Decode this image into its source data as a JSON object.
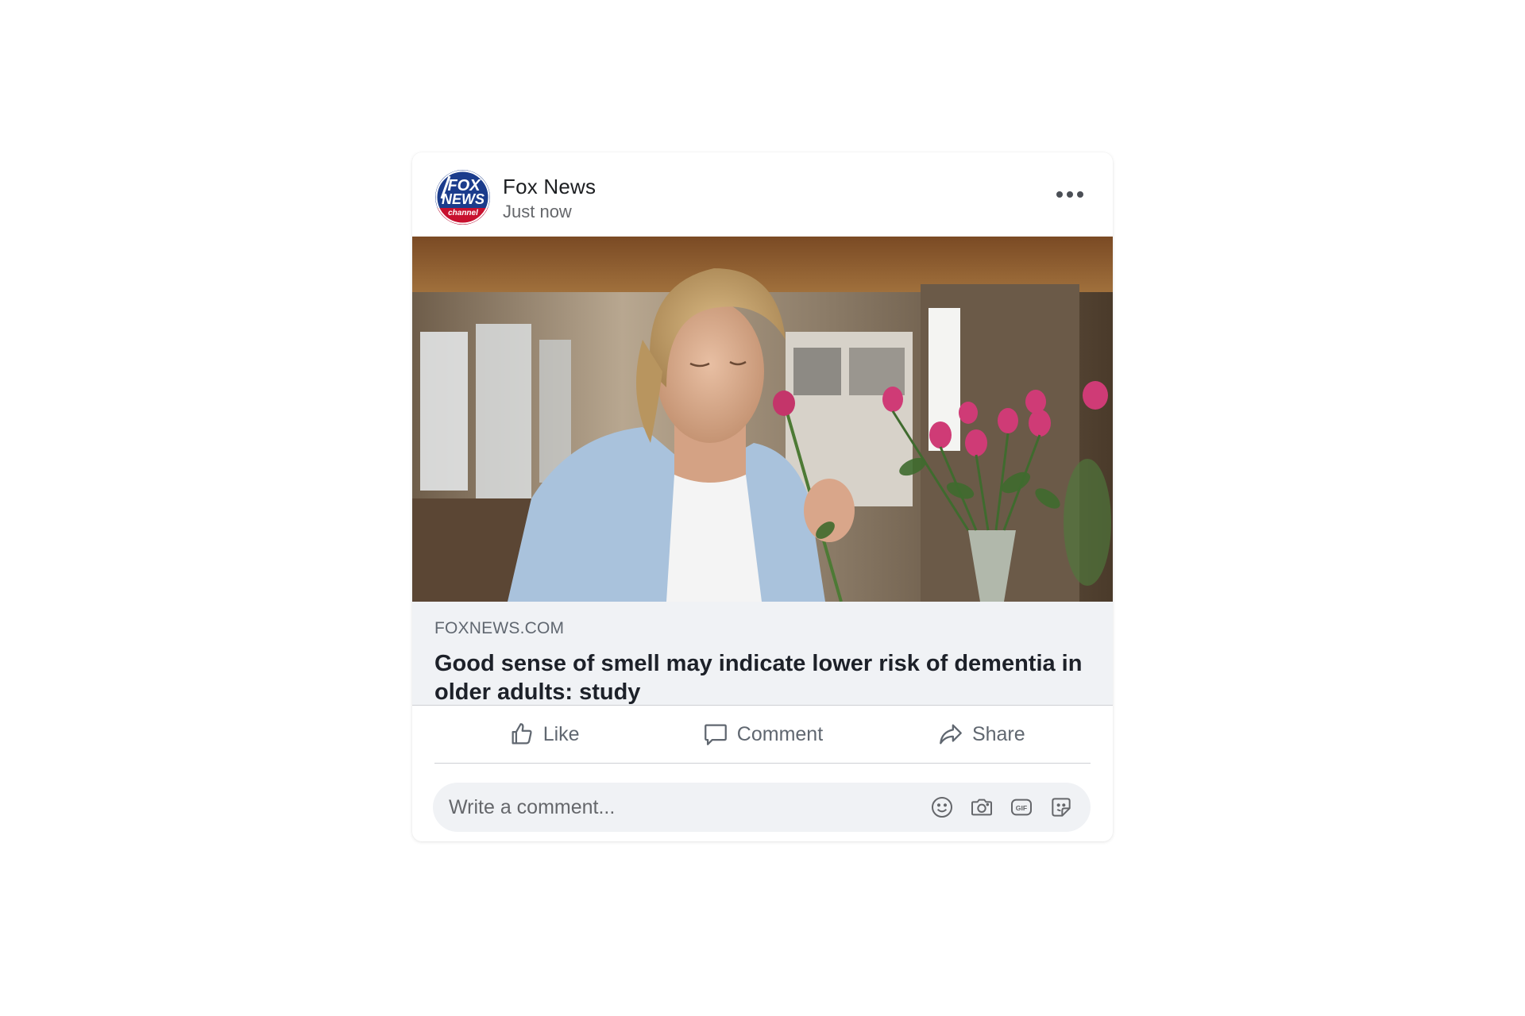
{
  "post": {
    "author": "Fox News",
    "timestamp": "Just now",
    "avatar_logo": {
      "line1": "FOX",
      "line2": "NEWS",
      "line3": "channel"
    },
    "image_alt": "Woman smelling a pink rose next to a vase of roses",
    "more_icon": "more-horizontal-icon"
  },
  "link_preview": {
    "domain": "FOXNEWS.COM",
    "title": "Good sense of smell may indicate lower risk of dementia in older adults: study"
  },
  "actions": {
    "like": "Like",
    "comment": "Comment",
    "share": "Share"
  },
  "comment_box": {
    "placeholder": "Write a comment...",
    "tools": [
      "emoji-icon",
      "camera-icon",
      "gif-icon",
      "sticker-icon"
    ]
  },
  "colors": {
    "text_primary": "#1c1e21",
    "text_secondary": "#65676b",
    "preview_bg": "#f0f2f5",
    "logo_blue": "#1b3c8c",
    "logo_red": "#c8102e"
  }
}
